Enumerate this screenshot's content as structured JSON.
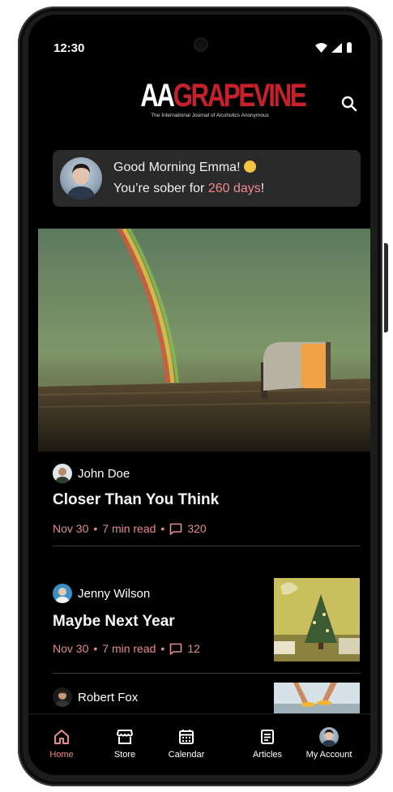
{
  "status": {
    "time": "12:30"
  },
  "header": {
    "logo_part1": "AA",
    "logo_part2": "GRAPEVINE",
    "logo_subtitle": "The International Journal of Alcoholics Anonymous"
  },
  "greeting": {
    "line1": "Good Morning Emma!",
    "line2_prefix": "You’re sober for ",
    "days": "260 days",
    "line2_suffix": "!"
  },
  "articles": [
    {
      "author": "John Doe",
      "title": "Closer Than You Think",
      "date": "Nov 30",
      "read": "7 min read",
      "comments": "320"
    },
    {
      "author": "Jenny Wilson",
      "title": "Maybe Next Year",
      "date": "Nov 30",
      "read": "7 min read",
      "comments": "12"
    },
    {
      "author": "Robert Fox"
    }
  ],
  "meta_separator": "•",
  "nav": [
    {
      "label": "Home",
      "icon": "home-icon",
      "active": true
    },
    {
      "label": "Store",
      "icon": "store-icon"
    },
    {
      "label": "Calendar",
      "icon": "calendar-icon"
    },
    {
      "label": "Articles",
      "icon": "articles-icon"
    },
    {
      "label": "My Account",
      "icon": "avatar"
    }
  ],
  "colors": {
    "accent": "#e58a8f",
    "logo_red": "#c8202a",
    "card_bg": "#2a2a2a"
  }
}
